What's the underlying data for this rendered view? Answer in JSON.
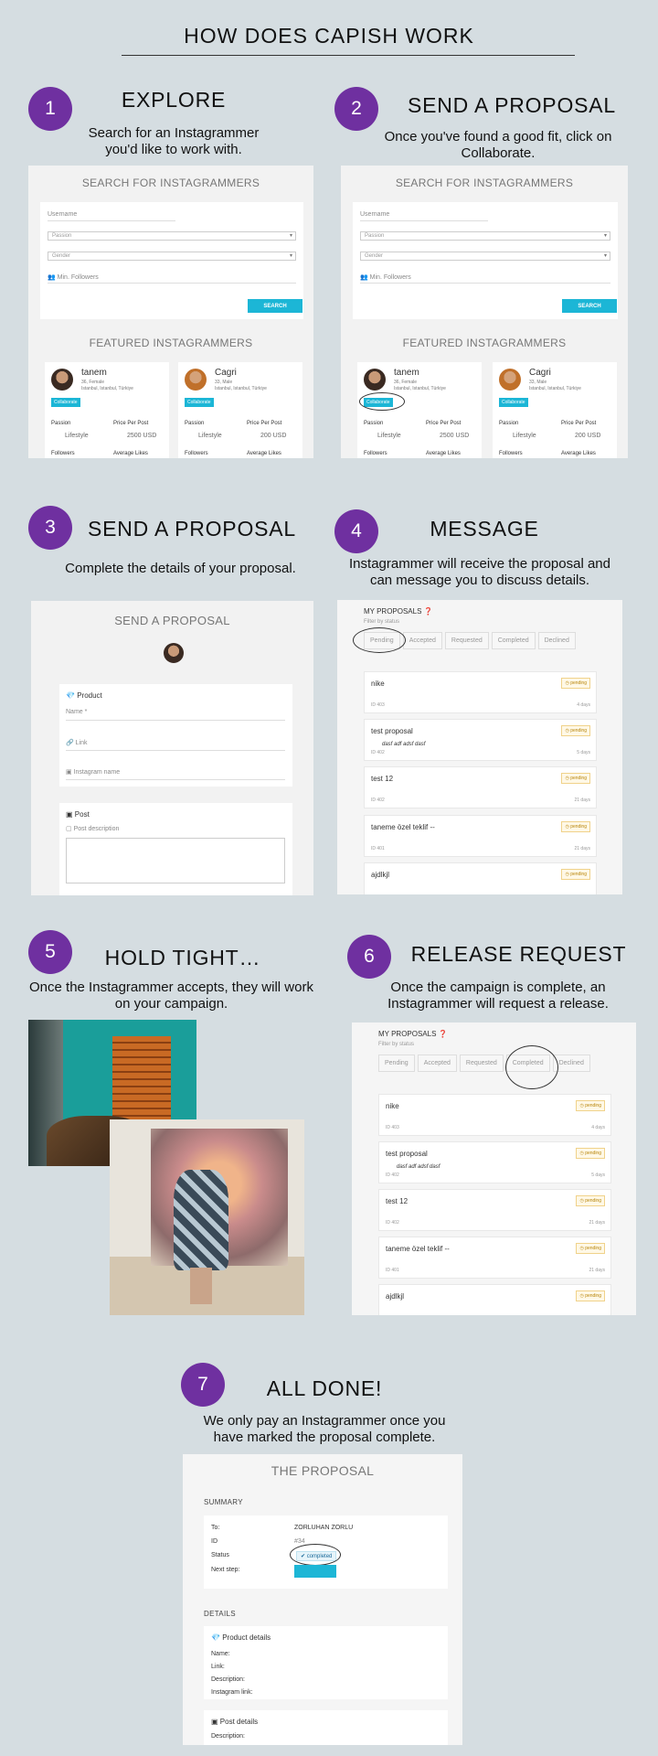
{
  "title": "HOW DOES CAPISH WORK",
  "colors": {
    "accent": "#6f30a0",
    "button": "#1cb6d6",
    "background": "#d5dde1"
  },
  "steps": [
    {
      "num": "1",
      "heading": "EXPLORE",
      "desc": "Search for an Instagrammer  you'd like to work with."
    },
    {
      "num": "2",
      "heading": "SEND A PROPOSAL",
      "desc": "Once you've found a good fit, click on Collaborate."
    },
    {
      "num": "3",
      "heading": "SEND A PROPOSAL",
      "desc": "Complete the details of your proposal."
    },
    {
      "num": "4",
      "heading": "MESSAGE",
      "desc": "Instagrammer  will receive the proposal and can message you to discuss details."
    },
    {
      "num": "5",
      "heading": "HOLD TIGHT…",
      "desc": "Once the Instagrammer accepts, they will work on your campaign."
    },
    {
      "num": "6",
      "heading": "RELEASE REQUEST",
      "desc": "Once the campaign is complete, an Instagrammer  will request a release."
    },
    {
      "num": "7",
      "heading": "ALL DONE!",
      "desc": "We only pay an Instagrammer  once you have marked the proposal complete."
    }
  ],
  "search": {
    "title": "SEARCH FOR INSTAGRAMMERS",
    "username": "Username",
    "passion": "Passion",
    "gender": "Gender",
    "min_followers": "Min. Followers",
    "button": "SEARCH",
    "featured_title": "FEATURED INSTAGRAMMERS",
    "cards": [
      {
        "name": "tanem",
        "meta": "36, Female",
        "loc": "Istanbul, Istanbul, Türkiye",
        "collab": "Collaborate",
        "passion_label": "Passion",
        "passion": "Lifestyle",
        "price_label": "Price Per Post",
        "price": "2500 USD",
        "followers_label": "Followers",
        "likes_label": "Average Likes"
      },
      {
        "name": "Cagri",
        "meta": "33, Male",
        "loc": "Istanbul, Istanbul, Türkiye",
        "collab": "Collaborate",
        "passion_label": "Passion",
        "passion": "Lifestyle",
        "price_label": "Price Per Post",
        "price": "200 USD",
        "followers_label": "Followers",
        "likes_label": "Average Likes"
      }
    ]
  },
  "proposal_form": {
    "title": "SEND A PROPOSAL",
    "product_label": "Product",
    "name_placeholder": "Name *",
    "link_placeholder": "Link",
    "instagram_placeholder": "Instagram name",
    "post_label": "Post",
    "post_desc": "Post description"
  },
  "my_proposals": {
    "title": "MY PROPOSALS",
    "filter": "Filter by status",
    "tabs": [
      "Pending",
      "Accepted",
      "Requested",
      "Completed",
      "Declined"
    ],
    "rows": [
      {
        "name": "nike",
        "id": "ID 403",
        "time": "4 days",
        "badge": "pending",
        "desc": ""
      },
      {
        "name": "test proposal",
        "id": "ID 402",
        "time": "5 days",
        "badge": "pending",
        "desc": "dasf adf adsf dasf"
      },
      {
        "name": "test 12",
        "id": "ID 402",
        "time": "21 days",
        "badge": "pending",
        "desc": ""
      },
      {
        "name": "taneme özel teklif --",
        "id": "ID 401",
        "time": "21 days",
        "badge": "pending",
        "desc": ""
      },
      {
        "name": "ajdlkjl",
        "id": "",
        "time": "",
        "badge": "pending",
        "desc": ""
      }
    ]
  },
  "the_proposal": {
    "title": "THE PROPOSAL",
    "summary": "SUMMARY",
    "to_label": "To:",
    "to_value": "ZORLUHAN ZORLU",
    "id_label": "ID",
    "id_value": "#34",
    "status_label": "Status",
    "status_value": "completed",
    "next_label": "Next step:",
    "details": "DETAILS",
    "product_details": "Product details",
    "name_label": "Name:",
    "link_label": "Link:",
    "description_label": "Description:",
    "instagram_label": "Instagram link:",
    "post_details": "Post details",
    "post_description_label": "Description:"
  }
}
